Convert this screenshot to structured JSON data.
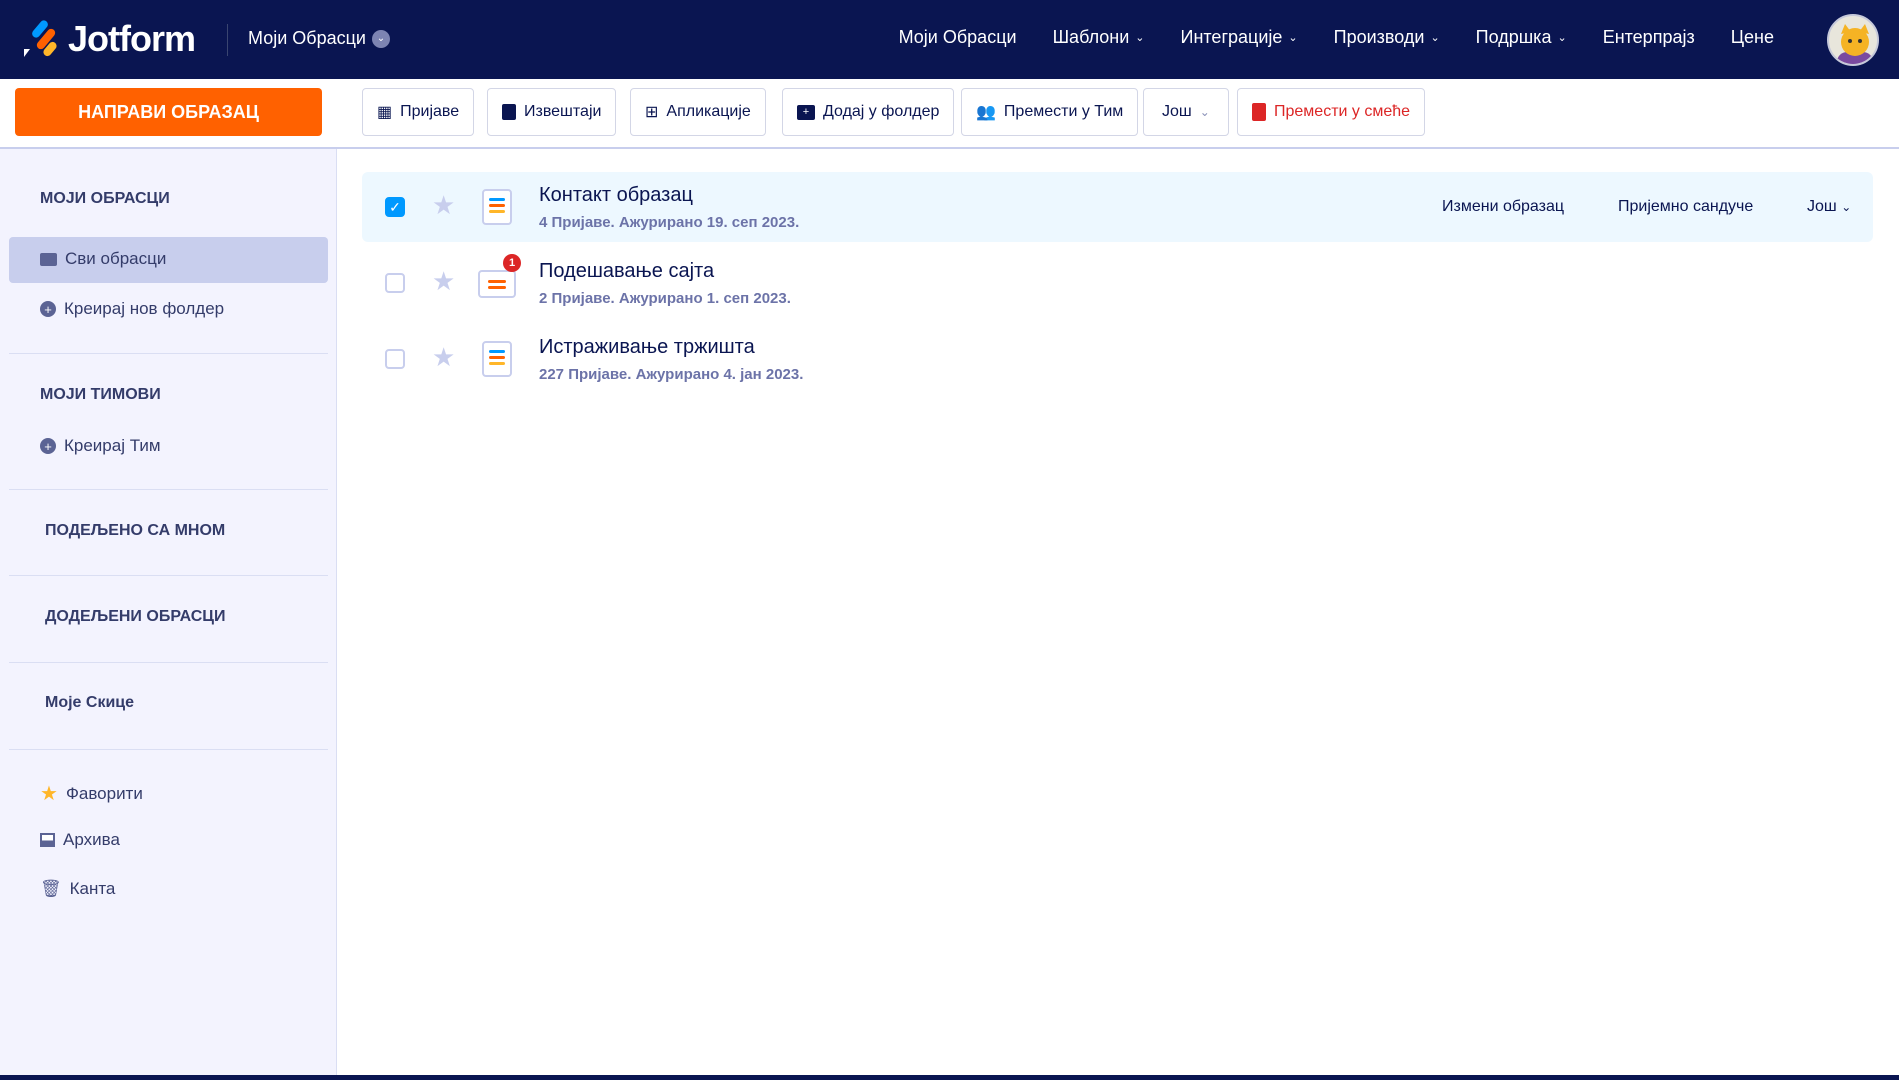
{
  "header": {
    "brand": "Jotform",
    "workspace": "Моји Обрасци",
    "nav": [
      {
        "label": "Моји Обрасци",
        "dropdown": false
      },
      {
        "label": "Шаблони",
        "dropdown": true
      },
      {
        "label": "Интеграције",
        "dropdown": true
      },
      {
        "label": "Производи",
        "dropdown": true
      },
      {
        "label": "Подршка",
        "dropdown": true
      },
      {
        "label": "Ентерпрајз",
        "dropdown": false
      },
      {
        "label": "Цене",
        "dropdown": false
      }
    ]
  },
  "sidebar": {
    "create_label": "НАПРАВИ ОБРАЗАЦ",
    "my_forms": "МОЈИ ОБРАСЦИ",
    "all_forms": "Сви обрасци",
    "new_folder": "Креирај нов фолдер",
    "my_teams": "МОЈИ ТИМОВИ",
    "create_team": "Креирај Тим",
    "shared": "ПОДЕЉЕНО СА МНОМ",
    "assigned": "ДОДЕЉЕНИ ОБРАСЦИ",
    "drafts": "Моје Скице",
    "favorites": "Фаворити",
    "archive": "Архива",
    "trash": "Канта"
  },
  "toolbar": {
    "submissions": "Пријаве",
    "reports": "Извештаји",
    "apps": "Апликације",
    "add_folder": "Додај у фолдер",
    "move_team": "Премести у Тим",
    "more": "Још",
    "trash": "Премести у смеће"
  },
  "forms": [
    {
      "title": "Контакт образац",
      "meta": "4 Пријаве. Ажурирано 19. сеп 2023.",
      "selected": true
    },
    {
      "title": "Подешавање сајта",
      "meta": "2 Пријаве. Ажурирано 1. сеп 2023.",
      "selected": false,
      "badge": "1"
    },
    {
      "title": "Истраживање тржишта",
      "meta": "227 Пријаве. Ажурирано 4. јан 2023.",
      "selected": false
    }
  ],
  "row_actions": {
    "edit": "Измени образац",
    "inbox": "Пријемно сандуче",
    "more": "Још"
  },
  "colors": {
    "navy": "#0a1551",
    "orange": "#ff6100",
    "blue": "#0099ff",
    "red": "#dc2626"
  }
}
